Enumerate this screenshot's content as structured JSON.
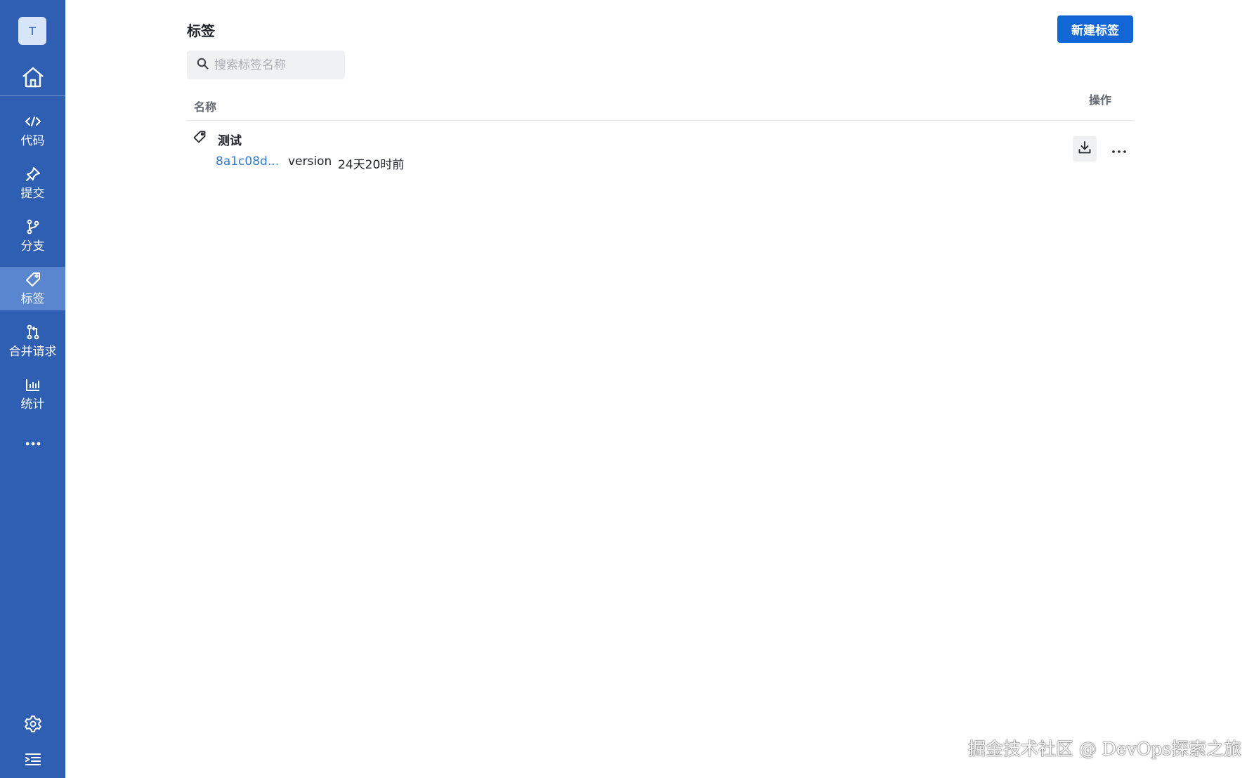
{
  "sidebar": {
    "avatar_letter": "T",
    "items": [
      {
        "label": "代码",
        "icon": "code-icon"
      },
      {
        "label": "提交",
        "icon": "pin-icon"
      },
      {
        "label": "分支",
        "icon": "branch-icon"
      },
      {
        "label": "标签",
        "icon": "tag-icon",
        "active": true
      },
      {
        "label": "合并请求",
        "icon": "merge-request-icon"
      },
      {
        "label": "统计",
        "icon": "stats-icon"
      }
    ],
    "more_icon": "ellipsis-icon",
    "bottom_icons": [
      "gear-icon",
      "collapse-menu-icon"
    ]
  },
  "header": {
    "title": "标签",
    "new_button_label": "新建标签"
  },
  "search": {
    "placeholder": "搜索标签名称",
    "value": ""
  },
  "table": {
    "columns": {
      "name": "名称",
      "action": "操作"
    },
    "rows": [
      {
        "name": "测试",
        "commit": "8a1c08d...",
        "message": "version",
        "time": "24天20时前"
      }
    ]
  },
  "watermark": "掘金技术社区 @ DevOps探索之旅",
  "colors": {
    "sidebar": "#2f5fb3",
    "sidebar_active": "#5a86d0",
    "primary": "#1366d6",
    "link": "#2d7ad6"
  }
}
